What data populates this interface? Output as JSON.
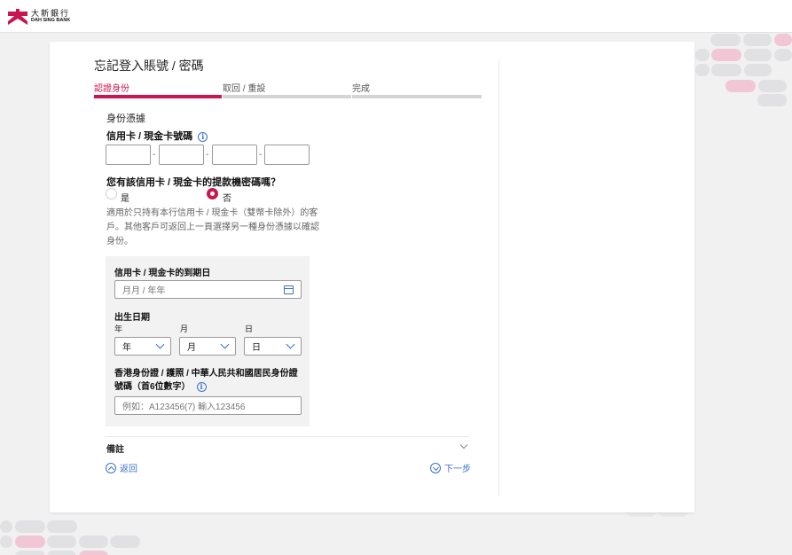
{
  "header": {
    "logo_cn": "大新銀行",
    "logo_en": "DAH SING BANK"
  },
  "page": {
    "title": "忘記登入賬號 / 密碼"
  },
  "steps": [
    {
      "label": "認證身份",
      "state": "active"
    },
    {
      "label": "取回 / 重設",
      "state": "pending"
    },
    {
      "label": "完成",
      "state": "pending"
    }
  ],
  "form": {
    "section_label": "身份憑據",
    "card_number_label": "信用卡 / 現金卡號碼",
    "pin_question": "您有該信用卡 / 現金卡的提款機密碼嗎？",
    "radio_yes": "是",
    "radio_no": "否",
    "radio_selected": "否",
    "help_text": "適用於只持有本行信用卡 / 現金卡（雙幣卡除外）的客戶。其他客戶可返回上一頁選擇另一種身份憑據以確認身份。",
    "expiry_label": "信用卡 / 現金卡的到期日",
    "expiry_placeholder": "月月 / 年年",
    "dob_label": "出生日期",
    "dob_year_label": "年",
    "dob_month_label": "月",
    "dob_day_label": "日",
    "dob_year_value": "年",
    "dob_month_value": "月",
    "dob_day_value": "日",
    "id_label_line1": "香港身份證 / 護照 / 中華人民共和國居民身份證",
    "id_label_line2": "號碼（首6位數字）",
    "id_placeholder": "例如：A123456(7) 輸入123456",
    "remarks": "備註"
  },
  "nav": {
    "back": "返回",
    "next": "下一步"
  },
  "colors": {
    "brand": "#c8174f",
    "link": "#3a6fd0",
    "deco_pink": "#f2c7d5",
    "deco_gray": "#e1e1e3"
  },
  "icons": [
    "logo-mark",
    "info-icon",
    "calendar-icon",
    "chevron-down-icon",
    "chevron-up-circle-icon",
    "chevron-down-circle-icon"
  ]
}
